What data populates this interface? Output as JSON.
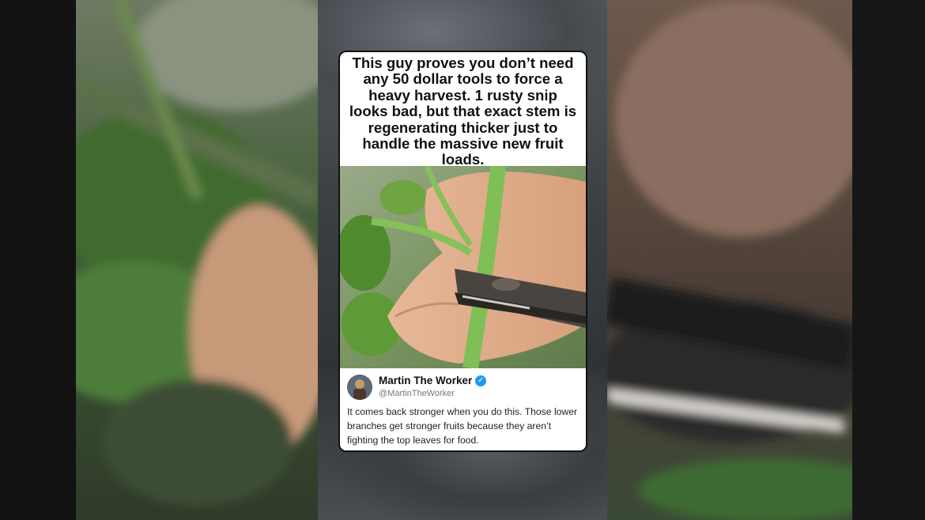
{
  "caption": {
    "text": "This guy proves you don’t need any 50 dollar tools to force a heavy harvest. 1 rusty snip looks bad, but that exact stem is regenerating thicker just to handle the massive new fruit loads."
  },
  "tweet": {
    "author_name": "Martin The Worker",
    "handle": "@MartinTheWorker",
    "verified": true,
    "text": "It comes back stronger when you do this. Those lower branches get stronger fruits because they aren’t fighting the top leaves for food."
  },
  "colors": {
    "verified_badge": "#1d9bf0",
    "card_background": "#ffffff",
    "card_border": "#111111"
  },
  "icons": {
    "verified": "verified-check-icon"
  }
}
